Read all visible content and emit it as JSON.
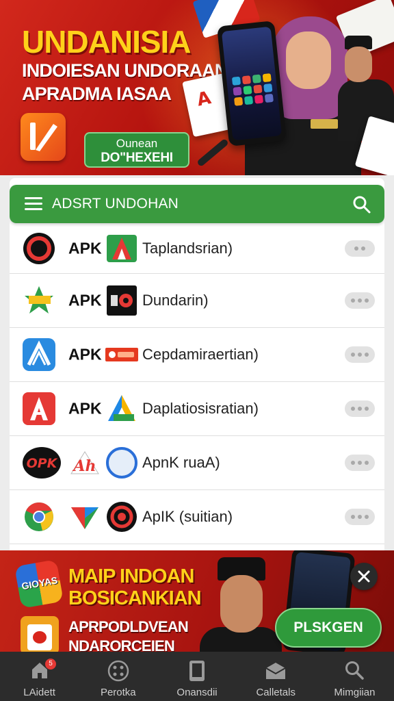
{
  "top_banner": {
    "title": "UNDANISIA",
    "line1": "INDOIESAN UNDORAAN",
    "line2": "APRADMA IASAA",
    "cta_line1": "Ounean",
    "cta_line2": "DO\"HEXEHI"
  },
  "list": {
    "header_title": "ADSRT UNDOHAN",
    "items": [
      {
        "tag": "APK",
        "name": "Taplandsrian)"
      },
      {
        "tag": "APK",
        "name": "Dundarin)"
      },
      {
        "tag": "APK",
        "name": "Cepdamiraertian)"
      },
      {
        "tag": "APK",
        "name": "Daplatiosisratian)"
      },
      {
        "tag": "",
        "name": "ApnK ruaA)"
      },
      {
        "tag": "",
        "name": "ApIK (suitian)"
      }
    ]
  },
  "ad_banner": {
    "logo_text": "GIOYAS",
    "title_line1": "MAIP INDOAN",
    "title_line2": "BOSICANKIAN",
    "sub_line1": "APRPODLDVEAN",
    "sub_line2": "NDARORCEIEN",
    "cta": "PLSKGEN"
  },
  "bottom_nav": {
    "badge": "5",
    "items": [
      {
        "label": "LAidett",
        "icon": "home-icon"
      },
      {
        "label": "Perotka",
        "icon": "apps-grid-icon"
      },
      {
        "label": "Onansdii",
        "icon": "phone-icon"
      },
      {
        "label": "Calletals",
        "icon": "categories-icon"
      },
      {
        "label": "Mimgiian",
        "icon": "search-icon"
      }
    ]
  },
  "colors": {
    "banner_red": "#c42417",
    "accent_green": "#3a9a3f",
    "title_yellow": "#ffd11a",
    "nav_bg": "#2c2c2c"
  }
}
